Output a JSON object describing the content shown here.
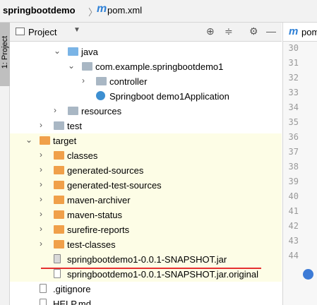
{
  "nav": {
    "project": "springbootdemo",
    "separator": "〉",
    "file": "pom.xml"
  },
  "stripe": {
    "tab_label": "1: Project"
  },
  "toolbar": {
    "title": "Project",
    "dropdown": "▼",
    "icons": [
      "locate-icon",
      "collapse-icon",
      "gear-icon",
      "hide-icon"
    ]
  },
  "editor": {
    "tab_label": "pom",
    "lines": [
      "30",
      "31",
      "32",
      "33",
      "34",
      "35",
      "36",
      "37",
      "38",
      "39",
      "40",
      "41",
      "42",
      "43",
      "44"
    ]
  },
  "tree": [
    {
      "label": "java",
      "indent": 82,
      "arrow": "⌄",
      "icon": "blue"
    },
    {
      "label": "com.example.springbootdemo1",
      "indent": 102,
      "arrow": "⌄",
      "icon": "gray"
    },
    {
      "label": "controller",
      "indent": 122,
      "arrow": "›",
      "icon": "gray"
    },
    {
      "label": "Springboot demo1Application",
      "indent": 122,
      "arrow": "",
      "icon": "class"
    },
    {
      "label": "resources",
      "indent": 82,
      "arrow": "›",
      "icon": "gray"
    },
    {
      "label": "test",
      "indent": 62,
      "arrow": "›",
      "icon": "gray"
    },
    {
      "label": "target",
      "indent": 42,
      "arrow": "⌄",
      "icon": "orange",
      "hl": true
    },
    {
      "label": "classes",
      "indent": 62,
      "arrow": "›",
      "icon": "orange",
      "hl": true
    },
    {
      "label": "generated-sources",
      "indent": 62,
      "arrow": "›",
      "icon": "orange",
      "hl": true
    },
    {
      "label": "generated-test-sources",
      "indent": 62,
      "arrow": "›",
      "icon": "orange",
      "hl": true
    },
    {
      "label": "maven-archiver",
      "indent": 62,
      "arrow": "›",
      "icon": "orange",
      "hl": true
    },
    {
      "label": "maven-status",
      "indent": 62,
      "arrow": "›",
      "icon": "orange",
      "hl": true
    },
    {
      "label": "surefire-reports",
      "indent": 62,
      "arrow": "›",
      "icon": "orange",
      "hl": true
    },
    {
      "label": "test-classes",
      "indent": 62,
      "arrow": "›",
      "icon": "orange",
      "hl": true
    },
    {
      "label": "springbootdemo1-0.0.1-SNAPSHOT.jar",
      "indent": 62,
      "arrow": "",
      "icon": "jar",
      "hl": true
    },
    {
      "label": "springbootdemo1-0.0.1-SNAPSHOT.jar.original",
      "indent": 62,
      "arrow": "",
      "icon": "file",
      "hl": true
    },
    {
      "label": ".gitignore",
      "indent": 42,
      "arrow": "",
      "icon": "file"
    },
    {
      "label": "HELP.md",
      "indent": 42,
      "arrow": "",
      "icon": "file"
    }
  ],
  "colors": {
    "highlight": "#fdfde6",
    "underline": "#e53030",
    "orange_folder": "#f0a04a",
    "blue_folder": "#7ab4e6"
  }
}
